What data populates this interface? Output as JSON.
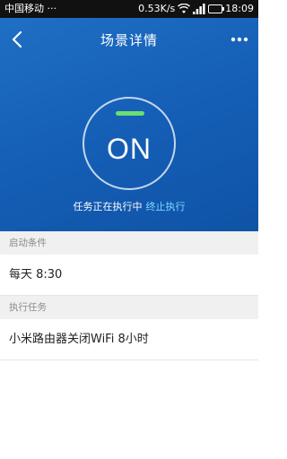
{
  "status_bar": {
    "carrier": "中国移动 ···",
    "speed": "0.53K/s",
    "time": "18:09"
  },
  "header": {
    "title": "场景详情",
    "back_icon": "chevron-left-icon",
    "more_icon": "more-horizontal-icon"
  },
  "toggle": {
    "state_text": "ON",
    "indicator_color": "#69e06e"
  },
  "execution": {
    "status_text": "任务正在执行中",
    "stop_label": "终止执行"
  },
  "sections": {
    "trigger": {
      "header": "启动条件",
      "value": "每天 8:30"
    },
    "task": {
      "header": "执行任务",
      "value": "小米路由器关闭WiFi 8小时"
    }
  },
  "colors": {
    "hero_blue": "#1660b8",
    "link": "#7fd7ff",
    "section_bg": "#f0f0f0"
  }
}
